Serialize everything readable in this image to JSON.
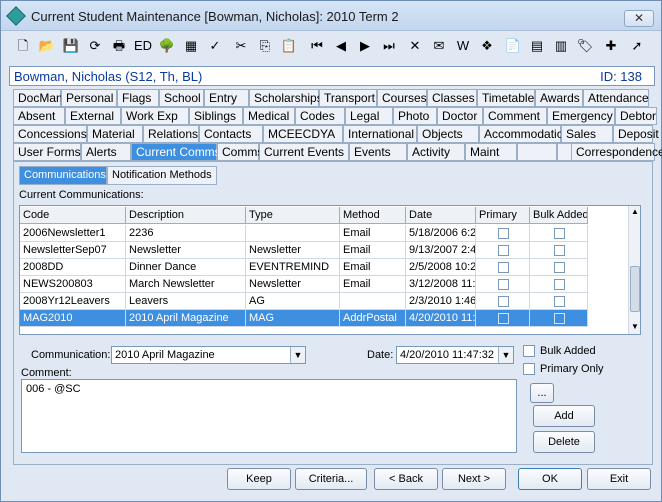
{
  "window": {
    "title": "Current Student Maintenance  [Bowman, Nicholas]:  2010 Term 2",
    "close_label": "✕"
  },
  "toolbar": {
    "items": [
      {
        "name": "new-icon",
        "glyph": "🗋"
      },
      {
        "name": "open-folder-icon",
        "glyph": "📂"
      },
      {
        "name": "save-icon",
        "glyph": "💾"
      },
      {
        "name": "refresh-icon",
        "glyph": "⟳"
      },
      {
        "name": "print-icon",
        "glyph": "🖶"
      },
      {
        "name": "edit-icon",
        "glyph": "ED"
      },
      {
        "name": "tree-icon",
        "glyph": "🌳"
      },
      {
        "name": "calculator-icon",
        "glyph": "▦"
      },
      {
        "name": "spellcheck-icon",
        "glyph": "✓"
      },
      {
        "name": "cut-icon",
        "glyph": "✂"
      },
      {
        "name": "copy-icon",
        "glyph": "⎘"
      },
      {
        "name": "paste-icon",
        "glyph": "📋"
      },
      {
        "name": "first-record-icon",
        "glyph": "⏮"
      },
      {
        "name": "previous-record-icon",
        "glyph": "◀"
      },
      {
        "name": "next-record-icon",
        "glyph": "▶"
      },
      {
        "name": "last-record-icon",
        "glyph": "⏭"
      },
      {
        "name": "delete-icon",
        "glyph": "✕"
      },
      {
        "name": "email-icon",
        "glyph": "✉"
      },
      {
        "name": "word-icon",
        "glyph": "W"
      },
      {
        "name": "network-icon",
        "glyph": "❖"
      },
      {
        "name": "clipboard-icon",
        "glyph": "📄"
      },
      {
        "name": "calendar-icon",
        "glyph": "▤"
      },
      {
        "name": "report-icon",
        "glyph": "▥"
      },
      {
        "name": "tag-icon",
        "glyph": "🏷"
      },
      {
        "name": "add-user-icon",
        "glyph": "✚"
      },
      {
        "name": "pointer-icon",
        "glyph": "➚"
      }
    ]
  },
  "student": {
    "name": "Bowman, Nicholas (S12, Th, BL)",
    "id_text": "ID: 138"
  },
  "tabs": {
    "row1": [
      "DocMan",
      "Personal",
      "Flags",
      "School",
      "Entry",
      "Scholarships",
      "Transport",
      "Courses",
      "Classes",
      "Timetable",
      "Awards",
      "Attendance"
    ],
    "row2": [
      "Absent",
      "External",
      "Work Exp",
      "Siblings",
      "Medical",
      "Codes",
      "Legal",
      "Photo",
      "Doctor",
      "Comment",
      "Emergency",
      "Debtor"
    ],
    "row3": [
      "Concessions",
      "Material",
      "Relations",
      "Contacts",
      "MCEECDYA",
      "International",
      "Objects",
      "Accommodation",
      "Sales",
      "Deposit"
    ],
    "row4": [
      "User Forms",
      "Alerts",
      "Current Comms",
      "Comms",
      "Current Events",
      "Events",
      "Activity",
      "Maint",
      "",
      "",
      "Correspondence"
    ]
  },
  "subtabs": [
    "Communications",
    "Notification Methods"
  ],
  "grid": {
    "caption": "Current Communications:",
    "headers": [
      "Code",
      "Description",
      "Type",
      "Method",
      "Date",
      "Primary",
      "Bulk Added"
    ],
    "rows": [
      [
        "2006Newsletter1",
        "2236",
        "",
        "Email",
        "5/18/2006 6:2"
      ],
      [
        "NewsletterSep07",
        "Newsletter",
        "Newsletter",
        "Email",
        "9/13/2007 2:4"
      ],
      [
        "2008DD",
        "Dinner Dance",
        "EVENTREMIND",
        "Email",
        "2/5/2008 10:2"
      ],
      [
        "NEWS200803",
        "March Newsletter",
        "Newsletter",
        "Email",
        "3/12/2008 11:"
      ],
      [
        "2008Yr12Leavers",
        "Leavers",
        "AG",
        "",
        "2/3/2010 1:46"
      ],
      [
        "MAG2010",
        "2010 April Magazine",
        "MAG",
        "AddrPostal",
        "4/20/2010 11:"
      ]
    ]
  },
  "form": {
    "communication_label": "Communication:",
    "communication_value": "2010 April Magazine",
    "date_label": "Date:",
    "date_value": "4/20/2010 11:47:32",
    "bulk_added_label": "Bulk Added",
    "primary_only_label": "Primary Only",
    "comment_label": "Comment:",
    "comment_value": "006 - @SC",
    "ellipsis_label": "...",
    "add_label": "Add",
    "delete_label": "Delete"
  },
  "footer": {
    "keep": "Keep",
    "criteria": "Criteria...",
    "back": "< Back",
    "next": "Next >",
    "ok": "OK",
    "exit": "Exit"
  }
}
